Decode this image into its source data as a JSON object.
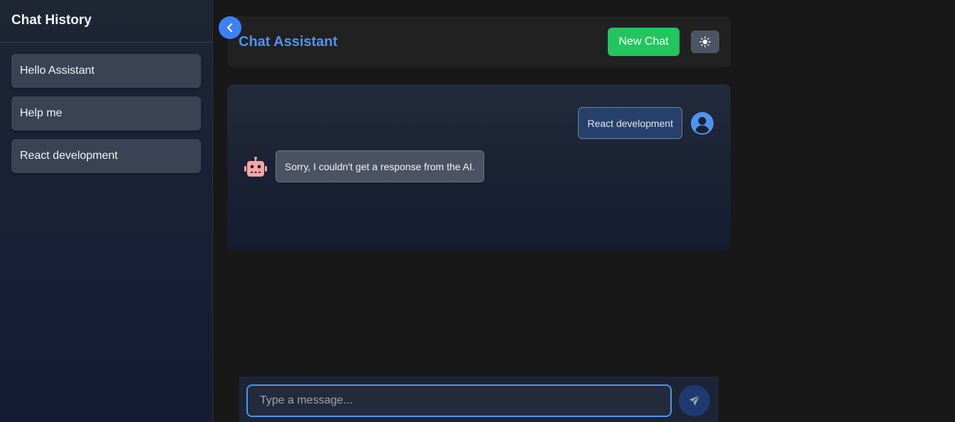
{
  "sidebar": {
    "title": "Chat History",
    "items": [
      {
        "label": "Hello Assistant"
      },
      {
        "label": "Help me"
      },
      {
        "label": "React development"
      }
    ]
  },
  "header": {
    "title": "Chat Assistant",
    "new_chat_label": "New Chat",
    "theme_icon": "sun-icon"
  },
  "messages": [
    {
      "role": "user",
      "text": "React development",
      "icon": "user-circle-icon"
    },
    {
      "role": "bot",
      "text": "Sorry, I couldn't get a response from the AI.",
      "icon": "robot-icon"
    }
  ],
  "input": {
    "placeholder": "Type a message...",
    "value": "",
    "send_icon": "paper-plane-icon"
  },
  "colors": {
    "accent": "#3b82f6",
    "title": "#4f93f0",
    "new_chat": "#22c55e",
    "bot_icon": "#fca5a5"
  }
}
